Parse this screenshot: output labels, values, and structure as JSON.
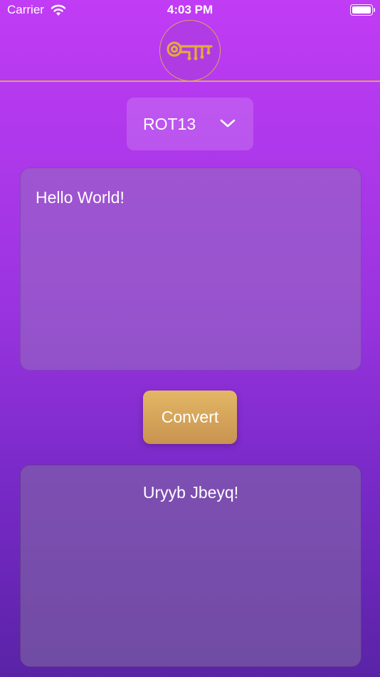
{
  "status_bar": {
    "carrier": "Carrier",
    "time": "4:03 PM",
    "wifi_icon": "wifi-icon",
    "battery_icon": "battery-icon"
  },
  "header": {
    "logo_icon": "key-icon",
    "accent_color": "#d7a85a"
  },
  "cipher_picker": {
    "selected": "ROT13",
    "icon": "chevron-down-icon"
  },
  "input": {
    "value": "Hello World!"
  },
  "convert_button": {
    "label": "Convert",
    "color": "#d9a95e"
  },
  "output": {
    "value": "Uryyb Jbeyq!"
  }
}
